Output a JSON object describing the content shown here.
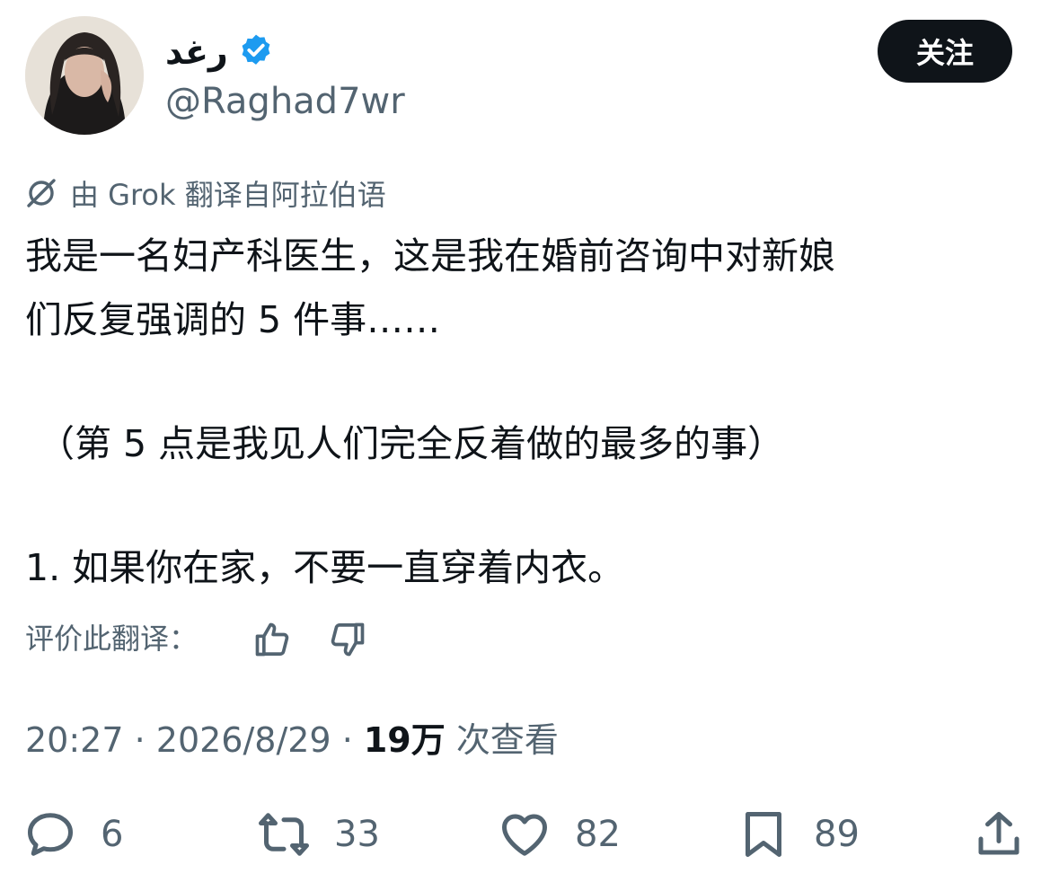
{
  "author": {
    "display_name": "رغد",
    "handle": "@Raghad7wr",
    "follow_label": "关注"
  },
  "translation": {
    "label": "由 Grok 翻译自阿拉伯语",
    "rate_label": "评价此翻译："
  },
  "tweet": {
    "line_1": "我是一名妇产科医生，这是我在婚前咨询中对新娘",
    "line_2": "们反复强调的 5 件事……",
    "line_3": "（第 5 点是我见人们完全反着做的最多的事）",
    "line_4": "1. 如果你在家，不要一直穿着内衣。"
  },
  "meta": {
    "time": "20:27",
    "separator": " · ",
    "date": "2026/8/29",
    "views_count": "19万",
    "views_label": " 次查看"
  },
  "actions": {
    "replies": "6",
    "reposts": "33",
    "likes": "82",
    "bookmarks": "89"
  },
  "colors": {
    "verified": "#1d9bf0",
    "text": "#0f1419",
    "secondary": "#536471"
  },
  "icons": [
    "verified-badge-icon",
    "grok-icon",
    "thumbs-up-icon",
    "thumbs-down-icon",
    "reply-icon",
    "repost-icon",
    "like-icon",
    "bookmark-icon",
    "share-icon"
  ]
}
